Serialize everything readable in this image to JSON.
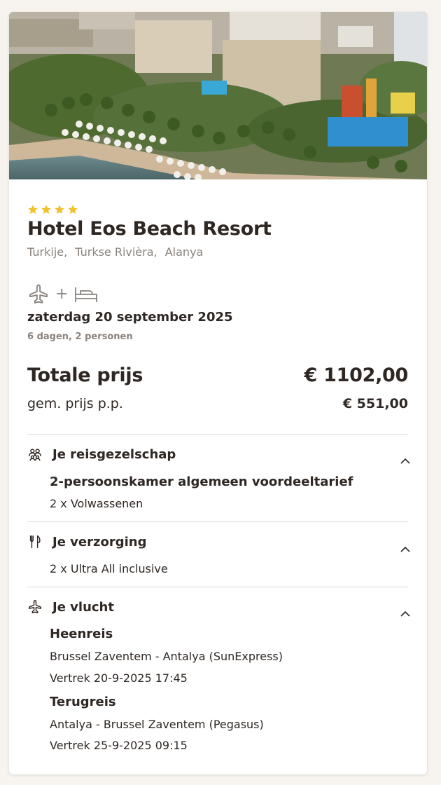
{
  "hotel": {
    "stars": 4,
    "name": "Hotel Eos Beach Resort",
    "location": [
      "Turkije,",
      "Turkse Rivièra,",
      "Alanya"
    ]
  },
  "trip": {
    "plus": "+",
    "date": "zaterdag 20 september 2025",
    "duration": "6 dagen, 2 personen"
  },
  "price": {
    "total_label": "Totale prijs",
    "total_value": "€ 1102,00",
    "pp_label": "gem. prijs p.p.",
    "pp_value": "€ 551,00"
  },
  "sections": {
    "party": {
      "title": "Je reisgezelschap",
      "room": "2-persoonskamer algemeen voordeeltarief",
      "guests": "2 x Volwassenen"
    },
    "board": {
      "title": "Je verzorging",
      "detail": "2 x Ultra All inclusive"
    },
    "flight": {
      "title": "Je vlucht",
      "outbound_label": "Heenreis",
      "outbound_route": "Brussel Zaventem - Antalya (SunExpress)",
      "outbound_time": "Vertrek 20-9-2025 17:45",
      "return_label": "Terugreis",
      "return_route": "Antalya - Brussel Zaventem (Pegasus)",
      "return_time": "Vertrek 25-9-2025 09:15"
    }
  },
  "colors": {
    "star": "#f2c12e",
    "text": "#2e2723",
    "muted": "#8a827c",
    "divider": "#dedad6"
  },
  "icons": [
    "star-icon",
    "plane-icon",
    "bed-icon",
    "people-icon",
    "cutlery-icon",
    "chevron-up-icon"
  ]
}
